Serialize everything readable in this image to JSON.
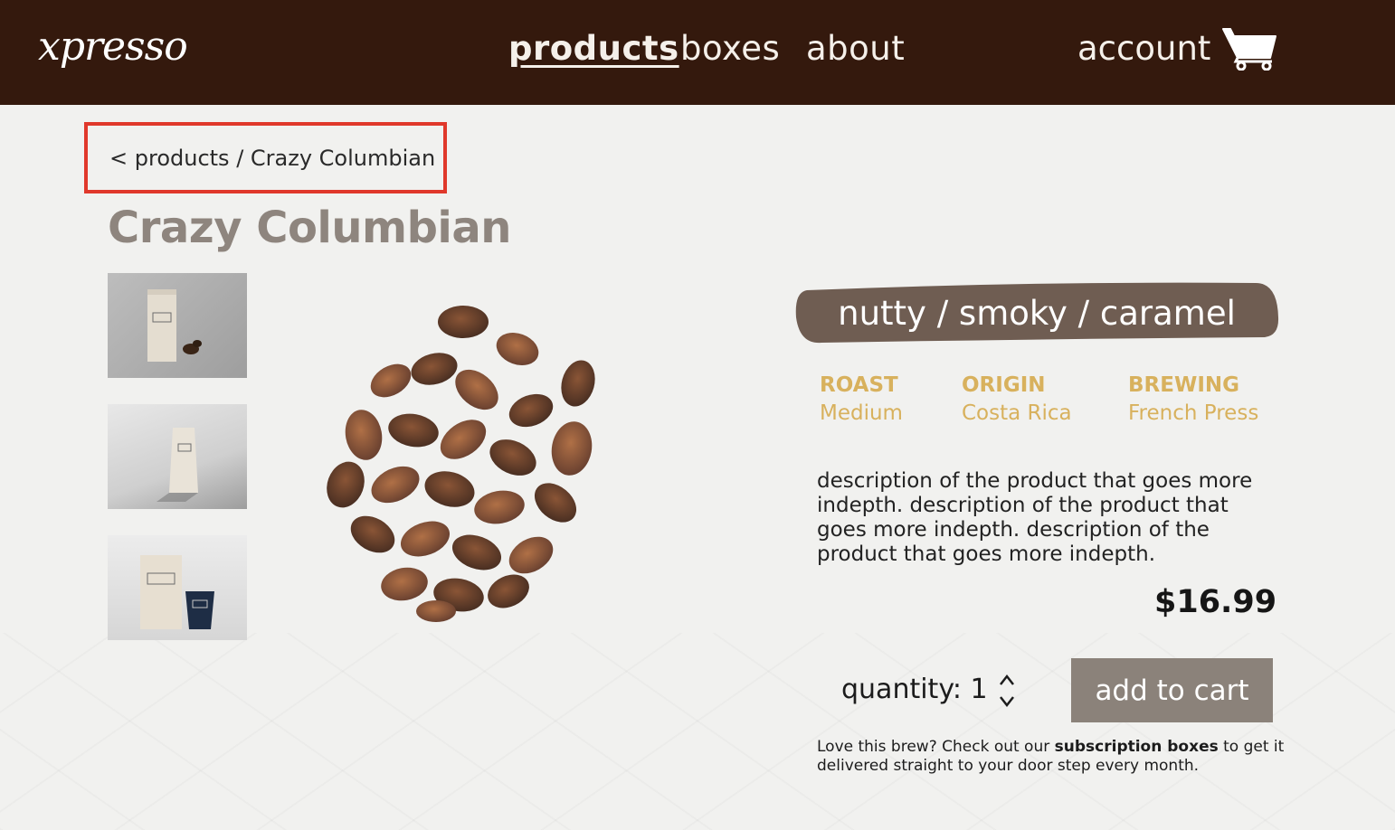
{
  "header": {
    "logo": "xpresso",
    "nav": [
      "products",
      "boxes",
      "about"
    ],
    "active_nav": "products",
    "account_label": "account",
    "cart_icon": "cart-icon"
  },
  "breadcrumb": {
    "back": "< products",
    "separator": " / ",
    "current": "Crazy Columbian"
  },
  "product": {
    "title": "Crazy Columbian",
    "flavor_notes": "nutty / smoky / caramel",
    "specs": [
      {
        "label": "ROAST",
        "value": "Medium"
      },
      {
        "label": "ORIGIN",
        "value": "Costa Rica"
      },
      {
        "label": "BREWING",
        "value": "French Press"
      }
    ],
    "description": "description of the product that goes more indepth. description of the product that goes more indepth. description of the product that goes more indepth.",
    "price": "$16.99",
    "quantity_label": "quantity:",
    "quantity_value": "1",
    "add_to_cart_label": "add to cart",
    "promo": {
      "before": "Love this brew? Check out our ",
      "link": "subscription boxes",
      "after": " to get it delivered straight to your door step every month."
    }
  },
  "colors": {
    "header_bg": "#34190d",
    "highlight_border": "#e0382b",
    "title": "#8e857e",
    "spec": "#d8b15d",
    "banner": "#6f5d52",
    "button": "#8b827a"
  }
}
